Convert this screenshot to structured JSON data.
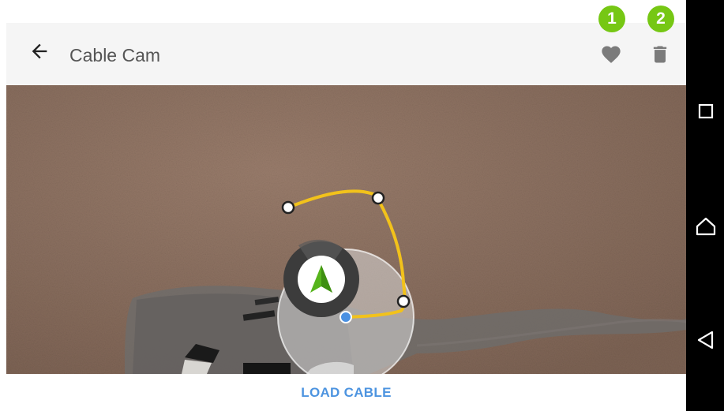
{
  "header": {
    "title": "Cable Cam",
    "back_icon": "arrow-left-icon",
    "favorite_icon": "heart-icon",
    "delete_icon": "trash-icon",
    "badges": [
      "1",
      "2"
    ],
    "badge_color": "#76c714"
  },
  "map": {
    "cable_color": "#f2c21b",
    "drone_arrow_color": "#56b41c",
    "home_point_color": "#4a90e2"
  },
  "footer": {
    "load_label": "LOAD CABLE",
    "accent": "#4d94e0"
  },
  "navbar": {
    "icons": [
      "recent-apps-icon",
      "home-icon",
      "back-icon"
    ]
  }
}
